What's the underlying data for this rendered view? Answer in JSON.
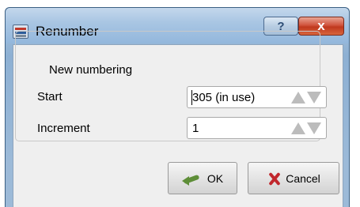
{
  "window": {
    "title": "Renumber",
    "help_label": "?",
    "close_label": "x"
  },
  "group": {
    "title": "New numbering"
  },
  "fields": {
    "start": {
      "label": "Start",
      "value": "305 (in use)"
    },
    "increment": {
      "label": "Increment",
      "value": "1"
    }
  },
  "buttons": {
    "ok_label": "OK",
    "cancel_label": "Cancel"
  },
  "icons": {
    "app": "renumber-app-icon",
    "ok": "green-arrow-icon",
    "cancel": "red-x-icon"
  },
  "colors": {
    "title_bar": "#a9c6e3",
    "close_button": "#c0381e",
    "client_bg": "#efefef"
  }
}
